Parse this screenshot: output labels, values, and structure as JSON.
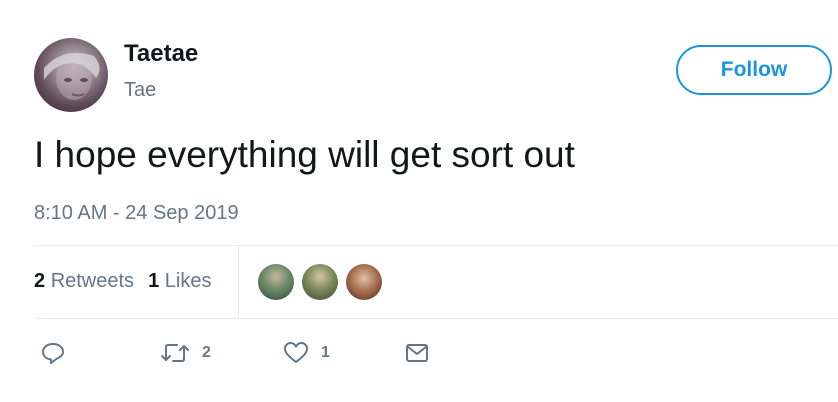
{
  "user": {
    "display_name": "Taetae",
    "handle": "Tae"
  },
  "follow_button": {
    "label": "Follow"
  },
  "tweet": {
    "text": "I hope everything will get sort out",
    "timestamp": "8:10 AM - 24 Sep 2019"
  },
  "stats": {
    "retweets_count": "2",
    "retweets_label": "Retweets",
    "likes_count": "1",
    "likes_label": "Likes"
  },
  "actions": {
    "reply": {
      "icon": "reply-icon"
    },
    "retweet": {
      "icon": "retweet-icon",
      "count": "2"
    },
    "like": {
      "icon": "heart-icon",
      "count": "1"
    },
    "message": {
      "icon": "envelope-icon"
    }
  },
  "colors": {
    "accent": "#1b95e0",
    "text_primary": "#14171a",
    "text_secondary": "#657786",
    "divider": "#e6ecf0"
  }
}
